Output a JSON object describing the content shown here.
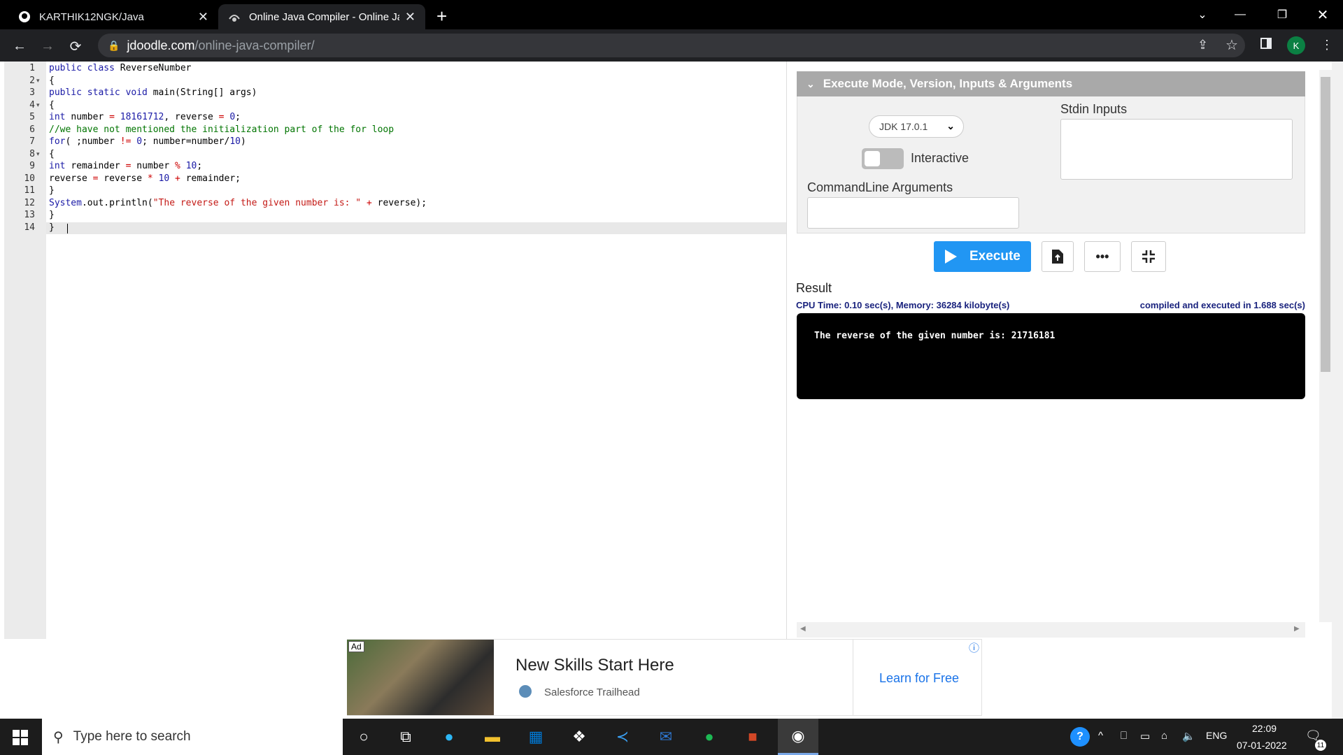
{
  "browser": {
    "tabs": [
      {
        "title": "KARTHIK12NGK/Java",
        "active": false
      },
      {
        "title": "Online Java Compiler - Online Ja",
        "active": true
      }
    ],
    "url_host": "jdoodle.com",
    "url_path": "/online-java-compiler/",
    "profile_initial": "K"
  },
  "editor": {
    "lines": [
      {
        "n": "1",
        "fold": ""
      },
      {
        "n": "2",
        "fold": "▾"
      },
      {
        "n": "3",
        "fold": ""
      },
      {
        "n": "4",
        "fold": "▾"
      },
      {
        "n": "5",
        "fold": ""
      },
      {
        "n": "6",
        "fold": ""
      },
      {
        "n": "7",
        "fold": ""
      },
      {
        "n": "8",
        "fold": "▾"
      },
      {
        "n": "9",
        "fold": ""
      },
      {
        "n": "10",
        "fold": ""
      },
      {
        "n": "11",
        "fold": ""
      },
      {
        "n": "12",
        "fold": ""
      },
      {
        "n": "13",
        "fold": ""
      },
      {
        "n": "14",
        "fold": ""
      }
    ],
    "code": [
      [
        [
          "kw",
          "public class "
        ],
        [
          "ident",
          "ReverseNumber"
        ]
      ],
      [
        [
          "ident",
          "{"
        ]
      ],
      [
        [
          "kw",
          "public static void "
        ],
        [
          "ident",
          "main(String[] args)"
        ]
      ],
      [
        [
          "ident",
          "{"
        ]
      ],
      [
        [
          "kw",
          "int "
        ],
        [
          "ident",
          "number "
        ],
        [
          "op",
          "= "
        ],
        [
          "num",
          "18161712"
        ],
        [
          "ident",
          ", reverse "
        ],
        [
          "op",
          "= "
        ],
        [
          "num",
          "0"
        ],
        [
          "ident",
          ";"
        ]
      ],
      [
        [
          "cmt",
          "//we have not mentioned the initialization part of the for loop"
        ]
      ],
      [
        [
          "kw",
          "for"
        ],
        [
          "ident",
          "( ;number "
        ],
        [
          "op",
          "!= "
        ],
        [
          "num",
          "0"
        ],
        [
          "ident",
          "; number=number/"
        ],
        [
          "num",
          "10"
        ],
        [
          "ident",
          ")"
        ]
      ],
      [
        [
          "ident",
          "{"
        ]
      ],
      [
        [
          "kw",
          "int "
        ],
        [
          "ident",
          "remainder "
        ],
        [
          "op",
          "= "
        ],
        [
          "ident",
          "number "
        ],
        [
          "op",
          "% "
        ],
        [
          "num",
          "10"
        ],
        [
          "ident",
          ";"
        ]
      ],
      [
        [
          "ident",
          "reverse "
        ],
        [
          "op",
          "= "
        ],
        [
          "ident",
          "reverse "
        ],
        [
          "op",
          "* "
        ],
        [
          "num",
          "10 "
        ],
        [
          "op",
          "+ "
        ],
        [
          "ident",
          "remainder;"
        ]
      ],
      [
        [
          "ident",
          "}"
        ]
      ],
      [
        [
          "kw",
          "System"
        ],
        [
          "ident",
          ".out.println("
        ],
        [
          "str",
          "\"The reverse of the given number is: \""
        ],
        [
          "ident",
          " "
        ],
        [
          "op",
          "+ "
        ],
        [
          "ident",
          "reverse);"
        ]
      ],
      [
        [
          "ident",
          "}"
        ]
      ],
      [
        [
          "ident",
          "}"
        ]
      ]
    ]
  },
  "panel": {
    "accordion_title": "Execute Mode, Version, Inputs & Arguments",
    "jdk_version": "JDK 17.0.1",
    "interactive_label": "Interactive",
    "stdin_label": "Stdin Inputs",
    "cmdargs_label": "CommandLine Arguments",
    "execute_label": "Execute",
    "result_label": "Result",
    "stats_left": "CPU Time: 0.10 sec(s), Memory: 36284 kilobyte(s)",
    "stats_right": "compiled and executed in 1.688 sec(s)",
    "output": "The reverse of the given number is: 21716181"
  },
  "ad": {
    "badge": "Ad",
    "headline": "New Skills Start Here",
    "advertiser": "Salesforce Trailhead",
    "cta": "Learn for Free",
    "info": "ⓘ"
  },
  "taskbar": {
    "search_placeholder": "Type here to search",
    "lang": "ENG",
    "time": "22:09",
    "date": "07-01-2022",
    "notifications": "11"
  }
}
